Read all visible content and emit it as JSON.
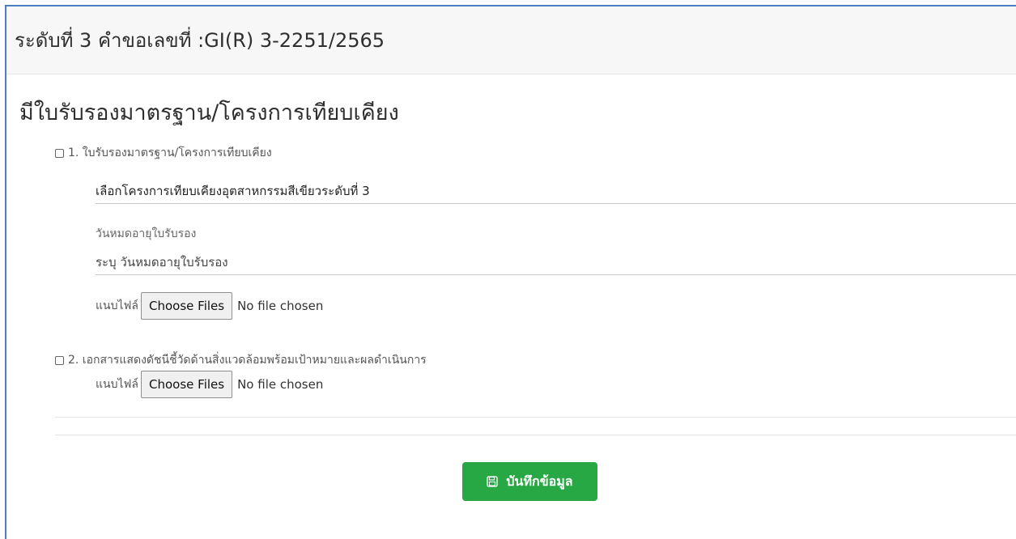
{
  "header": {
    "title": "ระดับที่ 3 คำขอเลขที่ :GI(R) 3-2251/2565"
  },
  "section": {
    "title": "มีใบรับรองมาตรฐาน/โครงการเทียบเคียง"
  },
  "item1": {
    "label": "1. ใบรับรองมาตรฐาน/โครงการเทียบเคียง",
    "checked": false,
    "select_value": "เลือกโครงการเทียบเคียงอุตสาหกรรมสีเขียวระดับที่ 3",
    "expiry_label": "วันหมดอายุใบรับรอง",
    "expiry_placeholder": "ระบุ วันหมดอายุใบรับรอง",
    "file_label": "แนบไฟล์",
    "file_button": "Choose Files",
    "file_status": "No file chosen"
  },
  "item2": {
    "label": "2. เอกสารแสดงดัชนีชี้วัดด้านสิ่งแวดล้อมพร้อมเป้าหมายและผลดำเนินการ",
    "checked": false,
    "file_label": "แนบไฟล์",
    "file_button": "Choose Files",
    "file_status": "No file chosen"
  },
  "actions": {
    "save_label": "บันทึกข้อมูล",
    "save_icon": "floppy-disk-icon",
    "save_color": "#28a745"
  },
  "colors": {
    "card_border": "#4a7ec0",
    "header_bg": "#f7f7f7"
  }
}
